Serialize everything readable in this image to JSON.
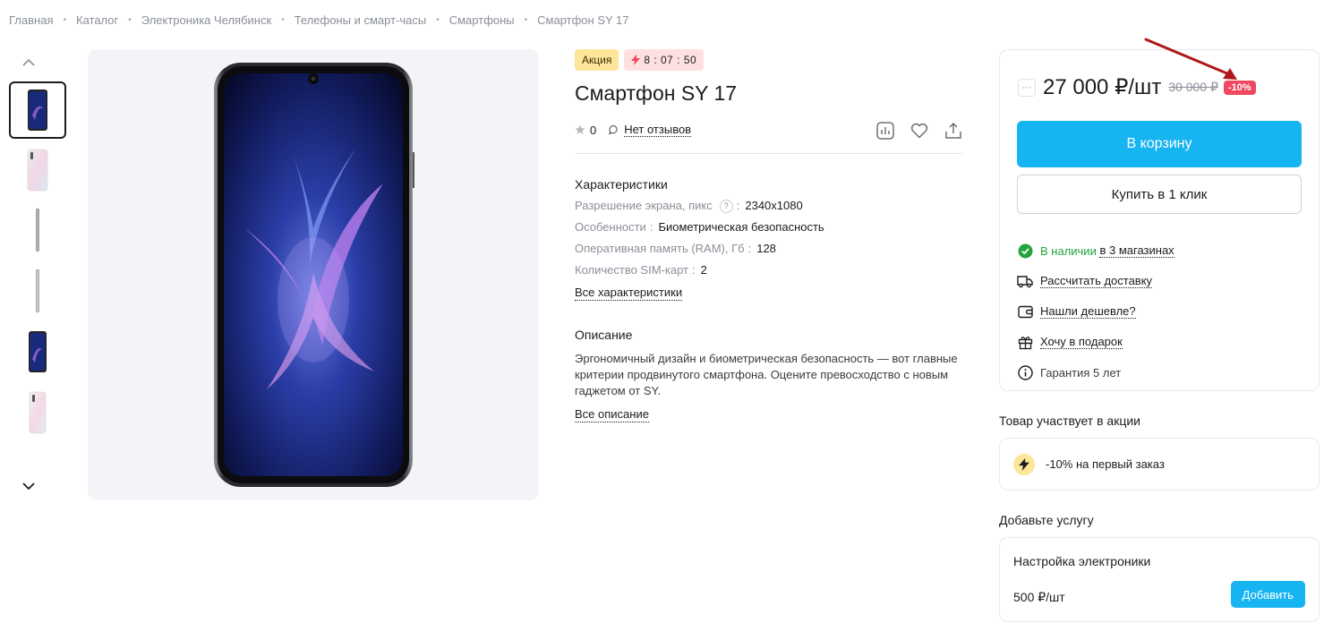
{
  "breadcrumbs": [
    "Главная",
    "Каталог",
    "Электроника Челябинск",
    "Телефоны и смарт-часы",
    "Смартфоны",
    "Смартфон SY 17"
  ],
  "product": {
    "promo_badge": "Акция",
    "timer": "8 : 07 : 50",
    "title": "Смартфон SY 17",
    "rating": "0",
    "reviews": "Нет отзывов"
  },
  "specs": {
    "title": "Характеристики",
    "rows": [
      {
        "key": "Разрешение экрана, пикс",
        "value": "2340x1080",
        "help": "?"
      },
      {
        "key": "Особенности",
        "value": "Биометрическая безопасность"
      },
      {
        "key": "Оперативная память (RAM), Гб",
        "value": "128"
      },
      {
        "key": "Количество SIM-карт",
        "value": "2"
      }
    ],
    "all_link": "Все характеристики"
  },
  "description": {
    "title": "Описание",
    "text": "Эргономичный дизайн и биометрическая безопасность — вот главные критерии продвинутого смартфона. Оцените превосходство с новым гаджетом от SY.",
    "all_link": "Все описание"
  },
  "buy": {
    "qty_icon": "···",
    "price": "27 000 ₽/шт",
    "old_price": "30 000 ₽",
    "discount": "-10%",
    "cart_button": "В корзину",
    "one_click_button": "Купить в 1 клик",
    "availability_status": "В наличии",
    "availability_stores": "в 3 магазинах",
    "delivery": "Рассчитать доставку",
    "cheaper": "Нашли дешевле?",
    "gift": "Хочу в подарок",
    "warranty": "Гарантия 5 лет"
  },
  "promo": {
    "title": "Товар участвует в акции",
    "text": "-10% на первый заказ"
  },
  "service": {
    "title": "Добавьте услугу",
    "name": "Настройка электроники",
    "price": "500 ₽/шт",
    "add_button": "Добавить"
  },
  "colors": {
    "accent": "#17b4f2",
    "discount": "#f04860",
    "in_stock": "#25a33d",
    "promo_yellow": "#fde59a"
  }
}
